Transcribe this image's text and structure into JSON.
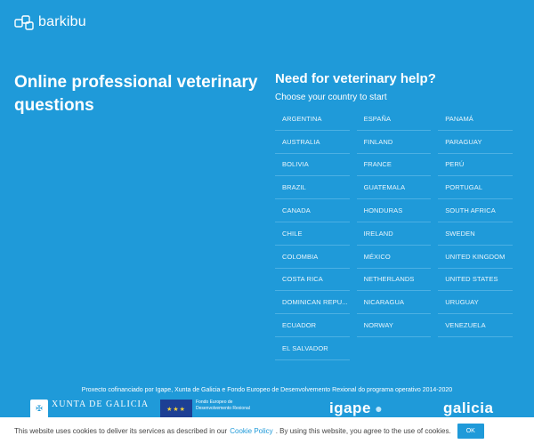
{
  "brand": {
    "name": "barkibu"
  },
  "hero": {
    "title": "Online professional veterinary questions"
  },
  "help": {
    "title": "Need for veterinary help?",
    "subtitle": "Choose your country to start"
  },
  "countries": [
    "ARGENTINA",
    "ESPAÑA",
    "PANAMÁ",
    "AUSTRALIA",
    "FINLAND",
    "PARAGUAY",
    "BOLIVIA",
    "FRANCE",
    "PERÚ",
    "BRAZIL",
    "GUATEMALA",
    "PORTUGAL",
    "CANADA",
    "HONDURAS",
    "SOUTH AFRICA",
    "CHILE",
    "IRELAND",
    "SWEDEN",
    "COLOMBIA",
    "MÉXICO",
    "UNITED KINGDOM",
    "COSTA RICA",
    "NETHERLANDS",
    "UNITED STATES",
    "DOMINICAN REPU...",
    "NICARAGUA",
    "URUGUAY",
    "ECUADOR",
    "NORWAY",
    "VENEZUELA",
    "EL SALVADOR"
  ],
  "footer": {
    "cofinance": "Proxecto cofinanciado por Igape, Xunta de Galicia e Fondo Europeo de Desenvolvemento Rexional do programa operativo 2014-2020",
    "xunta": "XUNTA DE GALICIA",
    "eu_line1": "Fondo Europeo de",
    "eu_line2": "Desenvolvemento Rexional",
    "igape": "igape",
    "galicia": "galicia"
  },
  "cookie": {
    "text_before": "This website uses cookies to deliver its services as described in our",
    "link": "Cookie Policy",
    "text_after": ". By using this website, you agree to the use of cookies.",
    "ok": "OK"
  },
  "colors": {
    "background": "#1f9ad9",
    "divider": "#4cb0e3"
  },
  "icons": {
    "logo": "dog-bone-logo-icon"
  }
}
